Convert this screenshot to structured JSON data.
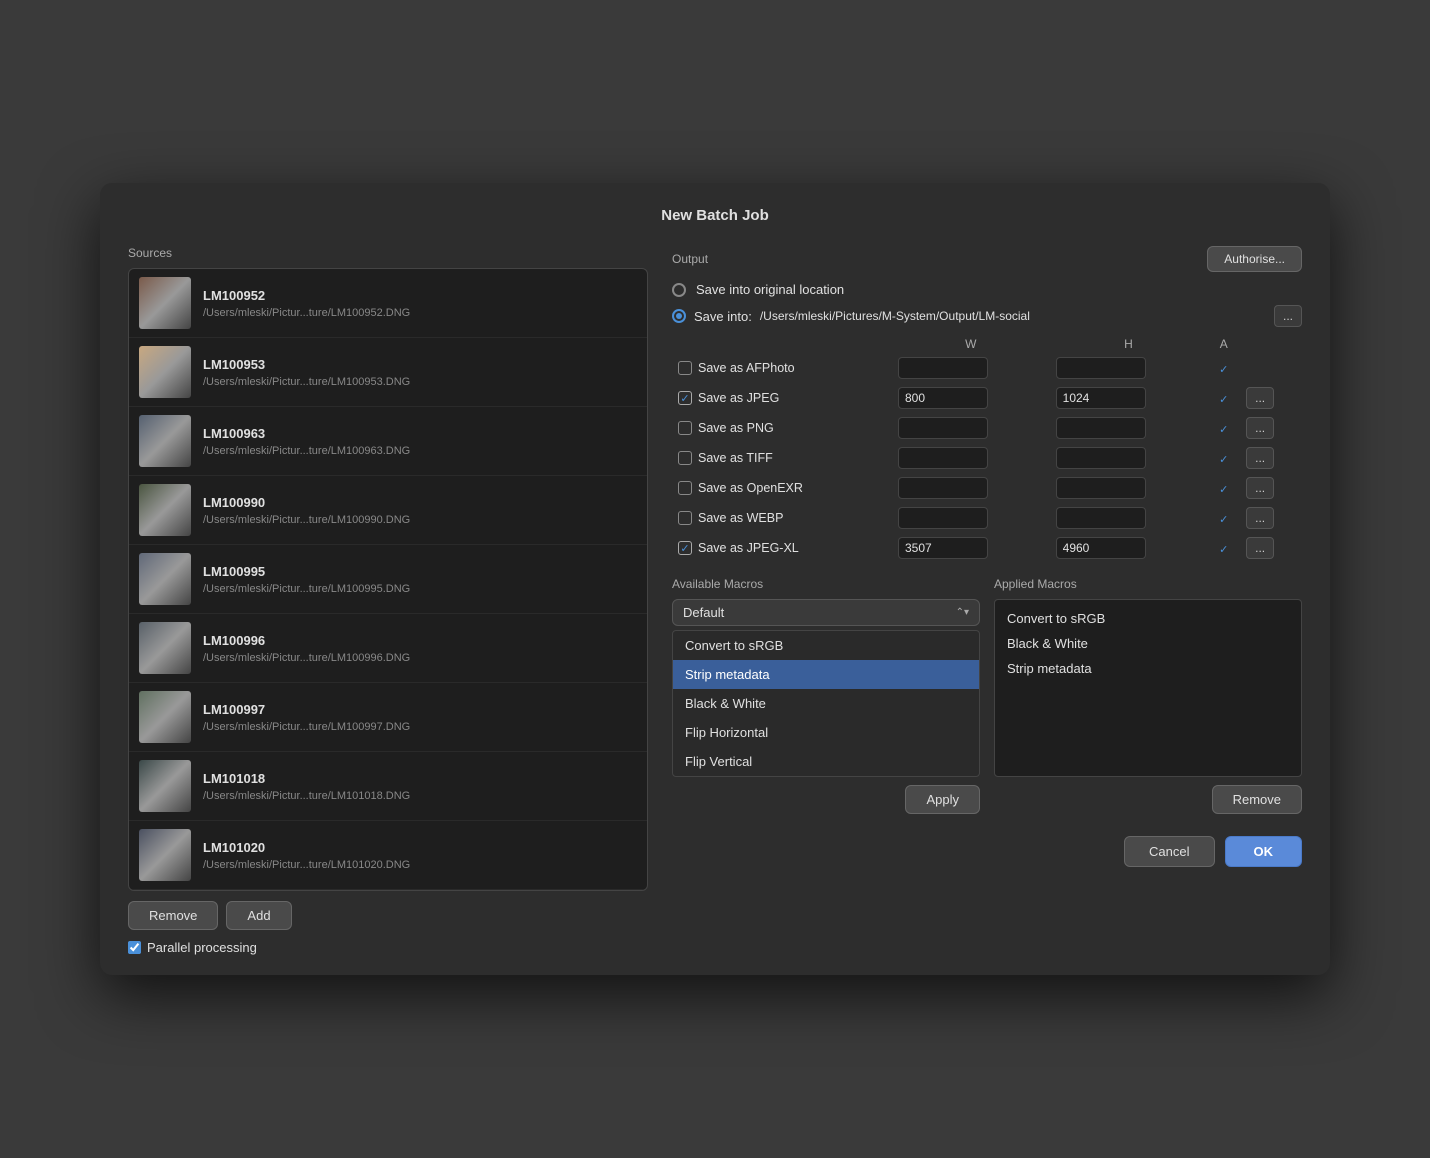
{
  "dialog": {
    "title": "New Batch Job"
  },
  "sources": {
    "label": "Sources",
    "items": [
      {
        "id": "LM100952",
        "path": "/Users/mleski/Pictur...ture/LM100952.DNG",
        "thumb_color": "#7a5a4a"
      },
      {
        "id": "LM100953",
        "path": "/Users/mleski/Pictur...ture/LM100953.DNG",
        "thumb_color": "#c8a880"
      },
      {
        "id": "LM100963",
        "path": "/Users/mleski/Pictur...ture/LM100963.DNG",
        "thumb_color": "#556070"
      },
      {
        "id": "LM100990",
        "path": "/Users/mleski/Pictur...ture/LM100990.DNG",
        "thumb_color": "#4a5540"
      },
      {
        "id": "LM100995",
        "path": "/Users/mleski/Pictur...ture/LM100995.DNG",
        "thumb_color": "#606878"
      },
      {
        "id": "LM100996",
        "path": "/Users/mleski/Pictur...ture/LM100996.DNG",
        "thumb_color": "#586068"
      },
      {
        "id": "LM100997",
        "path": "/Users/mleski/Pictur...ture/LM100997.DNG",
        "thumb_color": "#607060"
      },
      {
        "id": "LM101018",
        "path": "/Users/mleski/Pictur...ture/LM101018.DNG",
        "thumb_color": "#3a4848"
      },
      {
        "id": "LM101020",
        "path": "/Users/mleski/Pictur...ture/LM101020.DNG",
        "thumb_color": "#4a5060"
      }
    ],
    "remove_label": "Remove",
    "add_label": "Add"
  },
  "output": {
    "label": "Output",
    "save_original_label": "Save into original location",
    "save_into_label": "Save into:",
    "save_path": "/Users/mleski/Pictures/M-System/Output/LM-social",
    "authorise_label": "Authorise...",
    "ellipsis": "...",
    "table": {
      "col_w": "W",
      "col_h": "H",
      "col_a": "A",
      "rows": [
        {
          "label": "Save as AFPhoto",
          "checked": false,
          "w": "",
          "h": "",
          "aspect": true,
          "has_dots": false
        },
        {
          "label": "Save as JPEG",
          "checked": true,
          "w": "800",
          "h": "1024",
          "aspect": true,
          "has_dots": true
        },
        {
          "label": "Save as PNG",
          "checked": false,
          "w": "",
          "h": "",
          "aspect": true,
          "has_dots": true
        },
        {
          "label": "Save as TIFF",
          "checked": false,
          "w": "",
          "h": "",
          "aspect": true,
          "has_dots": true
        },
        {
          "label": "Save as OpenEXR",
          "checked": false,
          "w": "",
          "h": "",
          "aspect": true,
          "has_dots": true
        },
        {
          "label": "Save as WEBP",
          "checked": false,
          "w": "",
          "h": "",
          "aspect": true,
          "has_dots": true
        },
        {
          "label": "Save as JPEG-XL",
          "checked": true,
          "w": "3507",
          "h": "4960",
          "aspect": true,
          "has_dots": true
        }
      ]
    }
  },
  "macros": {
    "available_label": "Available Macros",
    "applied_label": "Applied Macros",
    "dropdown_label": "Default",
    "available_items": [
      {
        "id": "convert-srgb",
        "label": "Convert to sRGB",
        "selected": false
      },
      {
        "id": "strip-metadata",
        "label": "Strip metadata",
        "selected": true
      },
      {
        "id": "black-white",
        "label": "Black & White",
        "selected": false
      },
      {
        "id": "flip-horizontal",
        "label": "Flip Horizontal",
        "selected": false
      },
      {
        "id": "flip-vertical",
        "label": "Flip Vertical",
        "selected": false
      }
    ],
    "applied_items": [
      {
        "label": "Convert to sRGB"
      },
      {
        "label": "Black & White"
      },
      {
        "label": "Strip metadata"
      }
    ],
    "apply_label": "Apply",
    "remove_label": "Remove"
  },
  "footer": {
    "parallel_processing_label": "Parallel processing",
    "parallel_checked": true,
    "cancel_label": "Cancel",
    "ok_label": "OK"
  }
}
